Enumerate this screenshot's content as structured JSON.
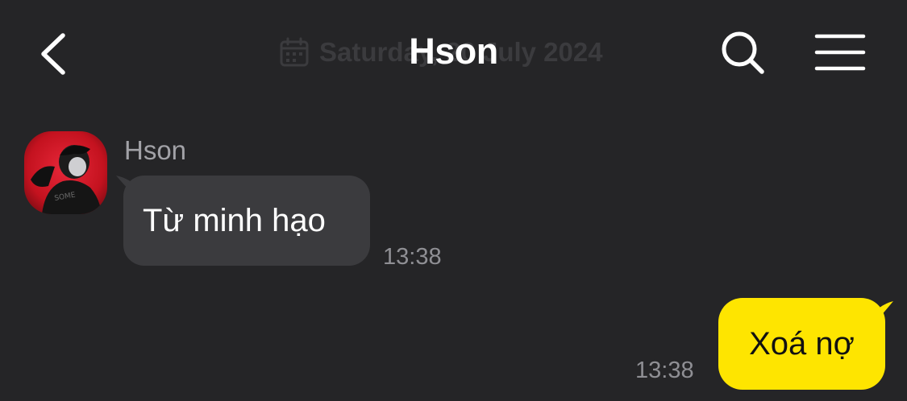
{
  "header": {
    "title": "Hson",
    "date_overlay": "Saturday, 20 July 2024",
    "back_icon": "chevron-left-icon",
    "search_icon": "search-icon",
    "menu_icon": "hamburger-menu-icon",
    "calendar_icon": "calendar-icon"
  },
  "messages": [
    {
      "direction": "incoming",
      "sender": "Hson",
      "text": "Từ minh hạo",
      "time": "13:38"
    },
    {
      "direction": "outgoing",
      "text": "Xoá nợ",
      "time": "13:38"
    }
  ],
  "colors": {
    "background": "#252527",
    "incoming_bubble": "#3b3b3e",
    "outgoing_bubble": "#fee500",
    "timestamp": "#8f8f94",
    "sender_name": "#a2a2a7"
  }
}
